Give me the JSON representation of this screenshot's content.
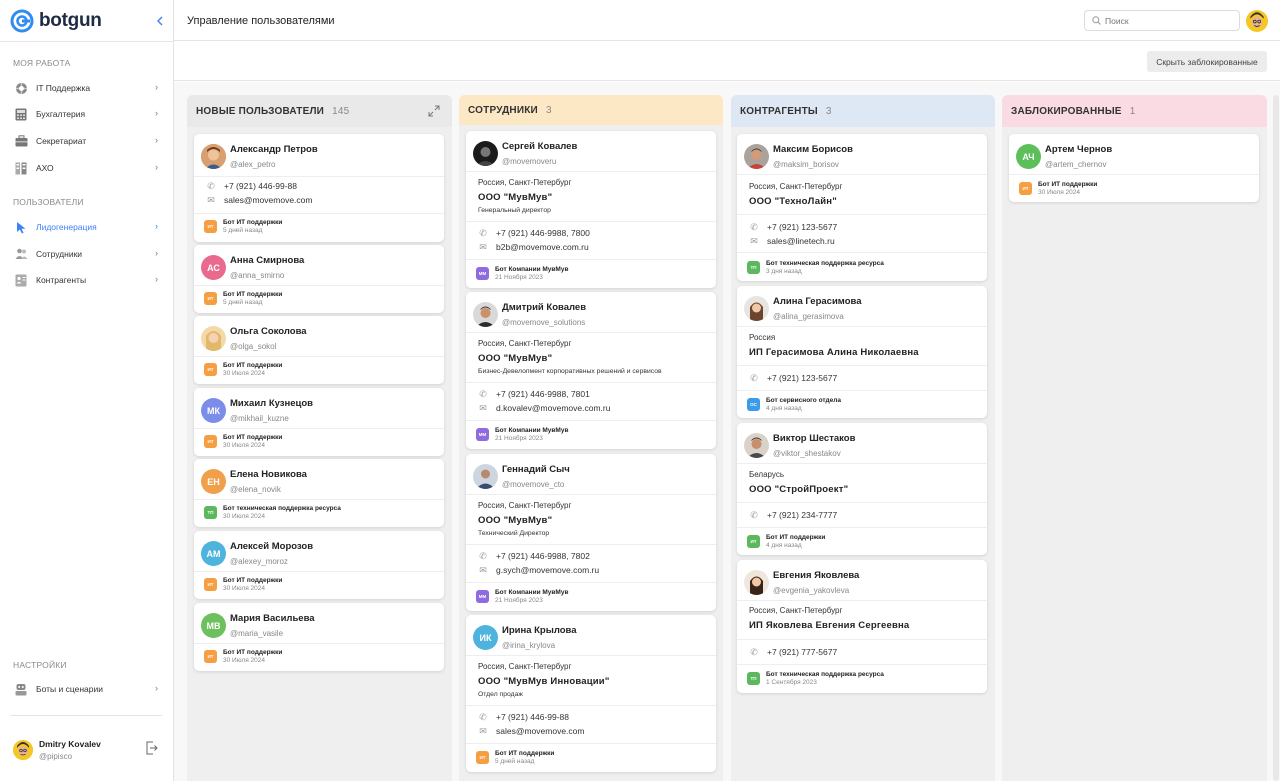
{
  "app": {
    "logo": "botgun"
  },
  "sidebar": {
    "work_title": "МОЯ РАБОТА",
    "work_items": [
      {
        "label": "IT Поддержка",
        "icon": "lifebuoy-icon"
      },
      {
        "label": "Бухгалтерия",
        "icon": "calculator-icon"
      },
      {
        "label": "Секретариат",
        "icon": "briefcase-icon"
      },
      {
        "label": "АХО",
        "icon": "building-icon"
      }
    ],
    "users_title": "ПОЛЬЗОВАТЕЛИ",
    "users_items": [
      {
        "label": "Лидогенерация",
        "icon": "cursor-icon"
      },
      {
        "label": "Сотрудники",
        "icon": "people-icon"
      },
      {
        "label": "Контрагенты",
        "icon": "contacts-icon"
      }
    ],
    "settings_title": "НАСТРОЙКИ",
    "settings_items": [
      {
        "label": "Боты и сценарии",
        "icon": "robot-icon"
      }
    ],
    "user": {
      "name": "Dmitry Kovalev",
      "nick": "@pipisco"
    }
  },
  "header": {
    "title": "Управление пользователями",
    "search_placeholder": "Поиск"
  },
  "toolbar": {
    "hide_blocked": "Скрыть заблокированные"
  },
  "colors": {
    "accent": "#3b82f6",
    "new_head": "#e9e9e9",
    "emp_head": "#fde8c6",
    "contr_head": "#dde8f4",
    "blocked_head": "#fadbe3"
  },
  "columns": [
    {
      "title": "НОВЫЕ ПОЛЬЗОВАТЕЛИ",
      "count": "145",
      "cards": [
        {
          "name": "Александр Петров",
          "handle": "@alex_petro",
          "phone": "+7 (921) 446-99-88",
          "email": "sales@movemove.com",
          "bot": "Бот ИТ поддержки",
          "bot_short": "ИТ",
          "when": "5 дней назад"
        },
        {
          "name": "Анна Смирнова",
          "handle": "@anna_smirno",
          "initials": "АС",
          "bot": "Бот ИТ поддержки",
          "bot_short": "ИТ",
          "when": "5 дней назад"
        },
        {
          "name": "Ольга Соколова",
          "handle": "@olga_sokol",
          "bot": "Бот ИТ поддержки",
          "bot_short": "ИТ",
          "when": "30 Июля 2024"
        },
        {
          "name": "Михаил Кузнецов",
          "handle": "@mikhail_kuzne",
          "initials": "МК",
          "bot": "Бот ИТ поддержки",
          "bot_short": "ИТ",
          "when": "30 Июля 2024"
        },
        {
          "name": "Елена Новикова",
          "handle": "@elena_novik",
          "initials": "ЕН",
          "bot": "Бот техническая поддержка ресурса",
          "bot_short": "ТП",
          "when": "30 Июля 2024"
        },
        {
          "name": "Алексей Морозов",
          "handle": "@alexey_moroz",
          "initials": "АМ",
          "bot": "Бот ИТ поддержки",
          "bot_short": "ИТ",
          "when": "30 Июля 2024"
        },
        {
          "name": "Мария Васильева",
          "handle": "@maria_vasile",
          "initials": "МВ",
          "bot": "Бот ИТ поддержки",
          "bot_short": "ИТ",
          "when": "30 Июля 2024"
        }
      ]
    },
    {
      "title": "СОТРУДНИКИ",
      "count": "3",
      "cards": [
        {
          "name": "Сергей Ковалев",
          "handle": "@movemoveru",
          "location": "Россия, Санкт-Петербург",
          "company": "ООО \"МувМув\"",
          "position": "Генеральный директор",
          "phone": "+7 (921) 446-9988, 7800",
          "email": "b2b@movemove.com.ru",
          "bot": "Бот Компании МувМув",
          "bot_short": "ММ",
          "when": "21 Ноября 2023"
        },
        {
          "name": "Дмитрий Ковалев",
          "handle": "@movemove_solutions",
          "location": "Россия, Санкт-Петербург",
          "company": "ООО \"МувМув\"",
          "position": "Бизнес-Девелопмент корпоративных решений и сервисов",
          "phone": "+7 (921) 446-9988, 7801",
          "email": "d.kovalev@movemove.com.ru",
          "bot": "Бот Компании МувМув",
          "bot_short": "ММ",
          "when": "21 Ноября 2023"
        },
        {
          "name": "Геннадий Сыч",
          "handle": "@movemove_cto",
          "location": "Россия, Санкт-Петербург",
          "company": "ООО \"МувМув\"",
          "position": "Технический Директор",
          "phone": "+7 (921) 446-9988, 7802",
          "email": "g.sych@movemove.com.ru",
          "bot": "Бот Компании МувМув",
          "bot_short": "ММ",
          "when": "21 Ноября 2023"
        },
        {
          "name": "Ирина Крылова",
          "handle": "@irina_krylova",
          "initials": "ИК",
          "location": "Россия, Санкт-Петербург",
          "company": "ООО \"МувМув Инновации\"",
          "position": "Отдел продаж",
          "phone": "+7 (921) 446-99-88",
          "email": "sales@movemove.com",
          "bot": "Бот ИТ поддержки",
          "bot_short": "ИТ",
          "when": "5 дней назад"
        }
      ]
    },
    {
      "title": "КОНТРАГЕНТЫ",
      "count": "3",
      "cards": [
        {
          "name": "Максим Борисов",
          "handle": "@maksim_borisov",
          "location": "Россия, Санкт-Петербург",
          "company": "ООО \"ТехноЛайн\"",
          "phone": "+7 (921) 123-5677",
          "email": "sales@linetech.ru",
          "bot": "Бот техническая поддержка ресурса",
          "bot_short": "ТП",
          "when": "3 дня назад"
        },
        {
          "name": "Алина Герасимова",
          "handle": "@alina_gerasimova",
          "location": "Россия",
          "company": "ИП Герасимова Алина Николаевна",
          "phone": "+7 (921) 123-5677",
          "bot": "Бот сервисного отдела",
          "bot_short": "ОС",
          "when": "4 дня назад"
        },
        {
          "name": "Виктор Шестаков",
          "handle": "@viktor_shestakov",
          "location": "Беларусь",
          "company": "ООО \"СтройПроект\"",
          "phone": "+7 (921) 234-7777",
          "bot": "Бот ИТ поддержки",
          "bot_short": "ИТ",
          "when": "4 дня назад"
        },
        {
          "name": "Евгения Яковлева",
          "handle": "@evgenia_yakovleva",
          "location": "Россия, Санкт-Петербург",
          "company": "ИП Яковлева Евгения Сергеевна",
          "phone": "+7 (921) 777-5677",
          "bot": "Бот техническая поддержка ресурса",
          "bot_short": "ТП",
          "when": "1 Сентября 2023"
        }
      ]
    },
    {
      "title": "ЗАБЛОКИРОВАННЫЕ",
      "count": "1",
      "cards": [
        {
          "name": "Артем Чернов",
          "handle": "@artem_chernov",
          "initials": "АЧ",
          "bot": "Бот ИТ поддержки",
          "bot_short": "ИТ",
          "when": "30 Июля 2024"
        }
      ]
    }
  ]
}
